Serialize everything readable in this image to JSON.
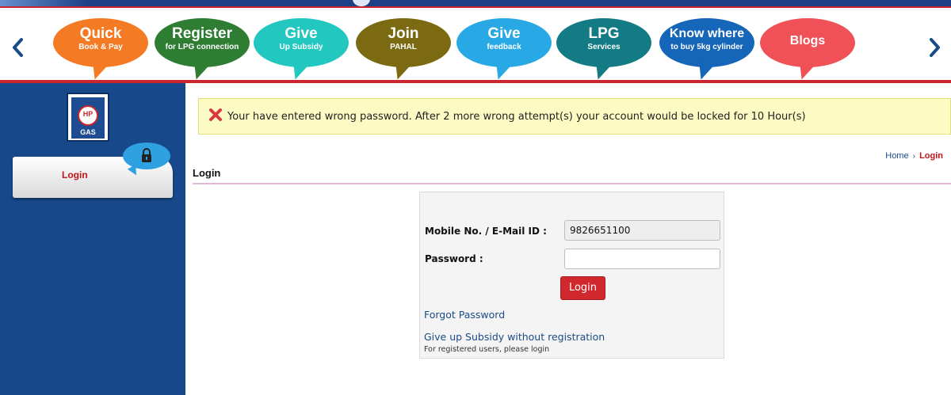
{
  "nav": {
    "items": [
      {
        "title": "Quick",
        "subtitle": "Book & Pay",
        "color": "#f47a23"
      },
      {
        "title": "Register",
        "subtitle": "for LPG connection",
        "color": "#2e7d32"
      },
      {
        "title": "Give",
        "subtitle": "Up Subsidy",
        "color": "#22c7c0"
      },
      {
        "title": "Join",
        "subtitle": "PAHAL",
        "color": "#7b6a12"
      },
      {
        "title": "Give",
        "subtitle": "feedback",
        "color": "#28a9e6"
      },
      {
        "title": "LPG",
        "subtitle": "Services",
        "color": "#137b84"
      },
      {
        "title": "Know where",
        "subtitle": "to buy 5kg cylinder",
        "color": "#1565b8"
      },
      {
        "title": "Blogs",
        "subtitle": "",
        "color": "#ef5157"
      }
    ],
    "prev_icon": "chevron-left-icon",
    "next_icon": "chevron-right-icon"
  },
  "sidebar": {
    "logo": {
      "top": "HP",
      "bottom": "GAS"
    },
    "login_label": "Login",
    "lock_icon": "lock-icon"
  },
  "alert": {
    "icon": "error-x-icon",
    "message": "Your have entered wrong password. After 2 more wrong attempt(s) your account would be locked for 10 Hour(s)"
  },
  "breadcrumb": {
    "home": "Home",
    "separator": "›",
    "current": "Login"
  },
  "page": {
    "title": "Login"
  },
  "form": {
    "mobile_label": "Mobile No. / E-Mail ID :",
    "mobile_value": "9826651100",
    "password_label": "Password :",
    "password_value": "",
    "login_button": "Login",
    "forgot_link": "Forgot Password",
    "giveup_link": "Give up Subsidy without registration",
    "giveup_note": "For registered users, please login"
  },
  "colors": {
    "brand_blue": "#17488a",
    "brand_red": "#c9262e",
    "alert_bg": "#fcfbc4"
  }
}
